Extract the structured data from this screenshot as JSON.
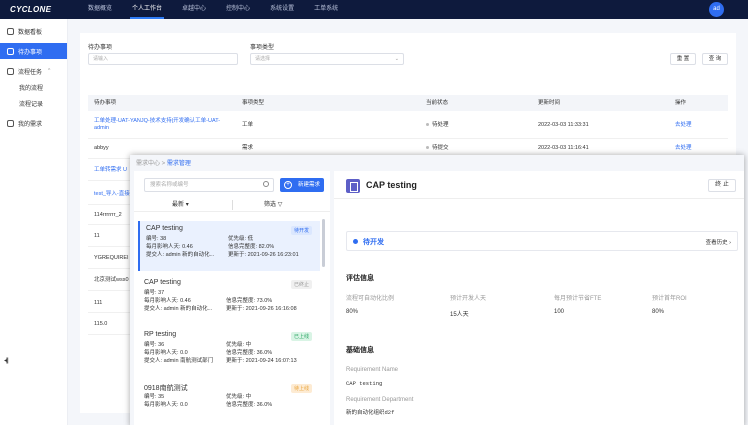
{
  "app": {
    "logo_main": "CYCLONE",
    "nav": [
      "数据概览",
      "个人工作台",
      "卓越中心",
      "控制中心",
      "系统设置",
      "工单系统"
    ],
    "active_nav_index": 1,
    "user_initials": "ad"
  },
  "sidebar": {
    "items": [
      {
        "label": "数据看板"
      },
      {
        "label": "待办事项"
      },
      {
        "label": "流程任务"
      }
    ],
    "sub_items": [
      "我的流程",
      "流程记录"
    ],
    "last_item": "我的需求",
    "collapse": "◂|||"
  },
  "todo": {
    "filter_item_label": "待办事项",
    "filter_item_placeholder": "请输入",
    "filter_type_label": "事项类型",
    "filter_type_placeholder": "请选择",
    "reset_label": "重 置",
    "query_label": "查 询",
    "columns": [
      "待办事项",
      "事项类型",
      "当前状态",
      "更新时间",
      "操作"
    ],
    "rows": [
      {
        "title": "工单处理-UAT-YANJQ-技术支持|开发确认工单-UAT-admin",
        "type": "工单",
        "status": "待处理",
        "time": "2022-03-03 11:33:31",
        "action": "去处理"
      },
      {
        "title": "abbyy",
        "type": "需求",
        "status": "待提交",
        "time": "2022-03-03 11:16:41",
        "action": "去处理"
      },
      {
        "title": "工单转需求 U",
        "type": "",
        "status": "",
        "time": "",
        "action": ""
      },
      {
        "title": "test_导入-直接",
        "type": "",
        "status": "",
        "time": "",
        "action": ""
      },
      {
        "title": "114rrrrrrr_2",
        "type": "",
        "status": "",
        "time": "",
        "action": ""
      },
      {
        "title": "11",
        "type": "",
        "status": "",
        "time": "",
        "action": ""
      },
      {
        "title": "YGREQUIREI",
        "type": "",
        "status": "",
        "time": "",
        "action": ""
      },
      {
        "title": "北京测试wss0",
        "type": "",
        "status": "",
        "time": "",
        "action": ""
      },
      {
        "title": "111",
        "type": "",
        "status": "",
        "time": "",
        "action": ""
      },
      {
        "title": "115.0",
        "type": "",
        "status": "",
        "time": "",
        "action": ""
      }
    ]
  },
  "overlay": {
    "breadcrumb_root": "需求中心",
    "breadcrumb_sep": " > ",
    "breadcrumb_current": "需求管理",
    "search_placeholder": "搜索名称或编号",
    "new_button": "新建需求",
    "sort_latest": "最新",
    "sort_filter": "筛选",
    "labels": {
      "id": "编号:",
      "priority": "优先级:",
      "impact": "每月影响人天:",
      "completeness": "信息完整度:",
      "submitter": "提交人:",
      "updated": "更新于:"
    },
    "cards": [
      {
        "title": "CAP testing",
        "badge": "待开发",
        "badge_class": "b-dev",
        "id": "38",
        "priority": "低",
        "impact": "0.46",
        "completeness": "82.0%",
        "submitter": "admin 新的自动化...",
        "updated": "2021-09-26 16:23:01"
      },
      {
        "title": "CAP testing",
        "badge": "已终止",
        "badge_class": "b-stop",
        "id": "37",
        "priority": "",
        "impact": "0.46",
        "completeness": "73.0%",
        "submitter": "admin 新的自动化...",
        "updated": "2021-09-26 16:16:08"
      },
      {
        "title": "RP testing",
        "badge": "已上线",
        "badge_class": "b-online",
        "id": "36",
        "priority": "中",
        "impact": "0.0",
        "completeness": "36.0%",
        "submitter": "admin 南航测试部门",
        "updated": "2021-09-24 16:07:13"
      },
      {
        "title": "0918南航测试",
        "badge": "待上线",
        "badge_class": "b-shelf",
        "id": "35",
        "priority": "中",
        "impact": "0.0",
        "completeness": "36.0%",
        "submitter": "",
        "updated": ""
      }
    ],
    "detail": {
      "title": "CAP testing",
      "stop_button": "终 止",
      "status": "待开发",
      "history": "查看历史",
      "history_chevron": "›",
      "eval_section": "评估信息",
      "eval_labels": [
        "流程可自动化比例",
        "预计开发人天",
        "每月预计节省FTE",
        "预计首年ROI"
      ],
      "eval_values": [
        "80%",
        "15人天",
        "100",
        "80%"
      ],
      "basic_section": "基础信息",
      "req_name_label": "Requirement Name",
      "req_name_value": "CAP testing",
      "req_dept_label": "Requirement Department",
      "req_dept_value": "新的自动化组织d2f"
    }
  }
}
